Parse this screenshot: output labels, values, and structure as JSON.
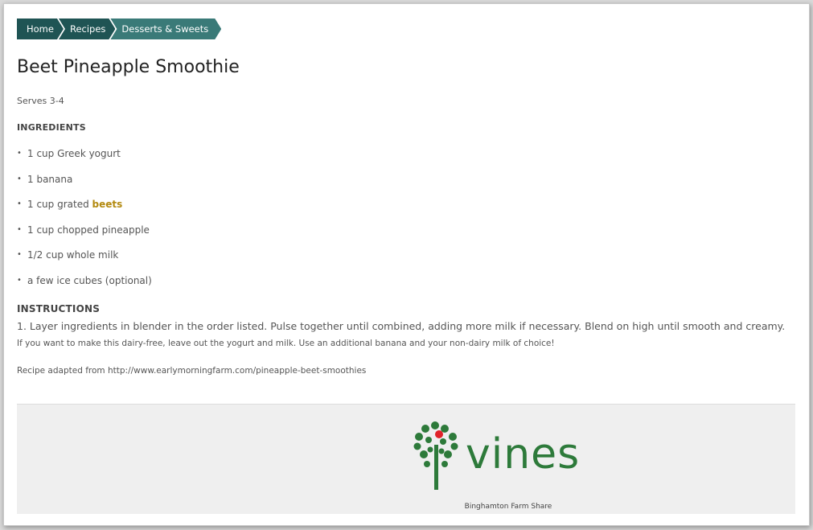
{
  "breadcrumb": [
    {
      "label": "Home"
    },
    {
      "label": "Recipes"
    },
    {
      "label": "Desserts & Sweets"
    }
  ],
  "title": "Beet Pineapple Smoothie",
  "serves": "Serves 3-4",
  "ingredients_heading": "INGREDIENTS",
  "ingredients": [
    {
      "text": "1 cup Greek yogurt"
    },
    {
      "text": "1 banana"
    },
    {
      "text": "1 cup grated ",
      "link": "beets"
    },
    {
      "text": "1 cup chopped pineapple"
    },
    {
      "text": "1/2 cup whole milk"
    },
    {
      "text": "a few ice cubes (optional)"
    }
  ],
  "instructions_heading": "INSTRUCTIONS",
  "instructions": "1. Layer ingredients in blender in the order listed. Pulse together until combined, adding more milk if necessary. Blend on high until smooth and creamy.",
  "note": "If you want to make this dairy-free, leave out the yogurt and milk. Use an additional banana and your non-dairy milk of choice!",
  "adapted": "Recipe adapted from http://www.earlymorningfarm.com/pineapple-beet-smoothies",
  "footer": {
    "logo_text": "vines",
    "tagline": "Binghamton Farm Share"
  },
  "colors": {
    "breadcrumb": "#1f5454",
    "breadcrumb_active": "#3a7a78",
    "link_highlight": "#b38a10",
    "logo_green": "#2d7a3a",
    "logo_red": "#e0242a"
  }
}
